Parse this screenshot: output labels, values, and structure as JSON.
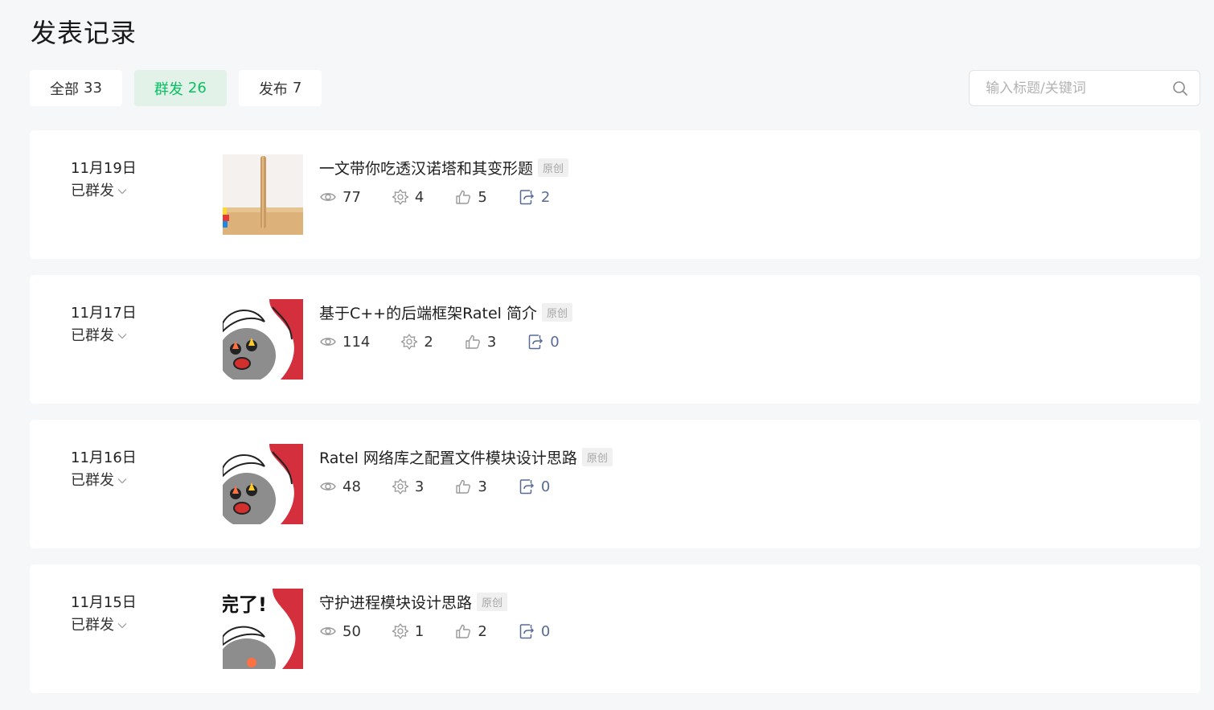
{
  "header": {
    "title": "发表记录"
  },
  "tabs": [
    {
      "label": "全部",
      "count": "33"
    },
    {
      "label": "群发",
      "count": "26"
    },
    {
      "label": "发布",
      "count": "7"
    }
  ],
  "search": {
    "placeholder": "输入标题/关键词"
  },
  "posts": [
    {
      "date": "11月19日",
      "status": "已群发",
      "thumb": "hanoi-tower",
      "title": "一文带你吃透汉诺塔和其变形题",
      "badge": "原创",
      "views": "77",
      "recommend": "4",
      "likes": "5",
      "shares": "2"
    },
    {
      "date": "11月17日",
      "status": "已群发",
      "thumb": "angry-bear",
      "title": "基于C++的后端框架Ratel 简介",
      "badge": "原创",
      "views": "114",
      "recommend": "2",
      "likes": "3",
      "shares": "0"
    },
    {
      "date": "11月16日",
      "status": "已群发",
      "thumb": "angry-bear",
      "title": "Ratel 网络库之配置文件模块设计思路",
      "badge": "原创",
      "views": "48",
      "recommend": "3",
      "likes": "3",
      "shares": "0"
    },
    {
      "date": "11月15日",
      "status": "已群发",
      "thumb": "angry-bear-text",
      "thumb_text": "完了!",
      "title": "守护进程模块设计思路",
      "badge": "原创",
      "views": "50",
      "recommend": "1",
      "likes": "2",
      "shares": "0"
    }
  ],
  "colors": {
    "accent": "#07c160",
    "share": "#576b95",
    "bg": "#f6f7f9"
  }
}
